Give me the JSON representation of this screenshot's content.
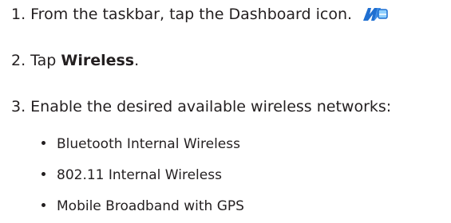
{
  "steps": [
    {
      "number": "1.",
      "text": "From the taskbar, tap the Dashboard icon.",
      "icon": "dashboard-icon"
    },
    {
      "number": "2.",
      "prefix": "Tap ",
      "bold": "Wireless",
      "suffix": "."
    },
    {
      "number": "3.",
      "text": "Enable the desired available wireless networks:",
      "bullets": [
        "Bluetooth Internal Wireless",
        "802.11 Internal Wireless",
        "Mobile Broadband with GPS"
      ]
    }
  ],
  "colors": {
    "text": "#231f20",
    "icon_blue": "#1f6fd1",
    "icon_light": "#8fd0ff"
  }
}
